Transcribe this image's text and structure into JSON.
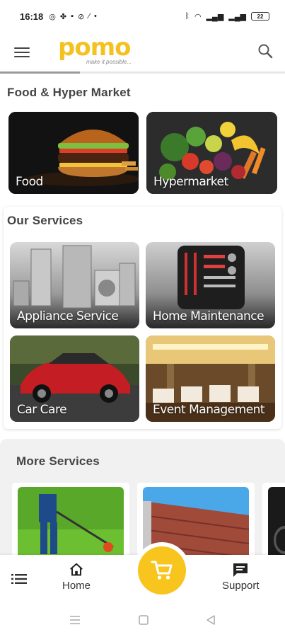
{
  "status_bar": {
    "time": "16:18",
    "battery": "22"
  },
  "header": {
    "brand": "pomo",
    "tagline": "make it possible...",
    "progress": 0.28
  },
  "food_section": {
    "title": "Food & Hyper Market",
    "cards": [
      {
        "label": "Food"
      },
      {
        "label": "Hypermarket"
      }
    ]
  },
  "services_section": {
    "title": "Our Services",
    "cards": [
      {
        "label": "Appliance Service"
      },
      {
        "label": "Home Maintenance"
      },
      {
        "label": "Car Care"
      },
      {
        "label": "Event Management"
      }
    ]
  },
  "more_section": {
    "title": "More Services"
  },
  "bottom_nav": {
    "home": "Home",
    "support": "Support"
  },
  "colors": {
    "brand_yellow": "#f4c220",
    "cart_fab": "#f7c51e"
  },
  "icons": [
    "menu-icon",
    "search-icon",
    "list-icon",
    "home-icon",
    "cart-icon",
    "chat-icon"
  ]
}
